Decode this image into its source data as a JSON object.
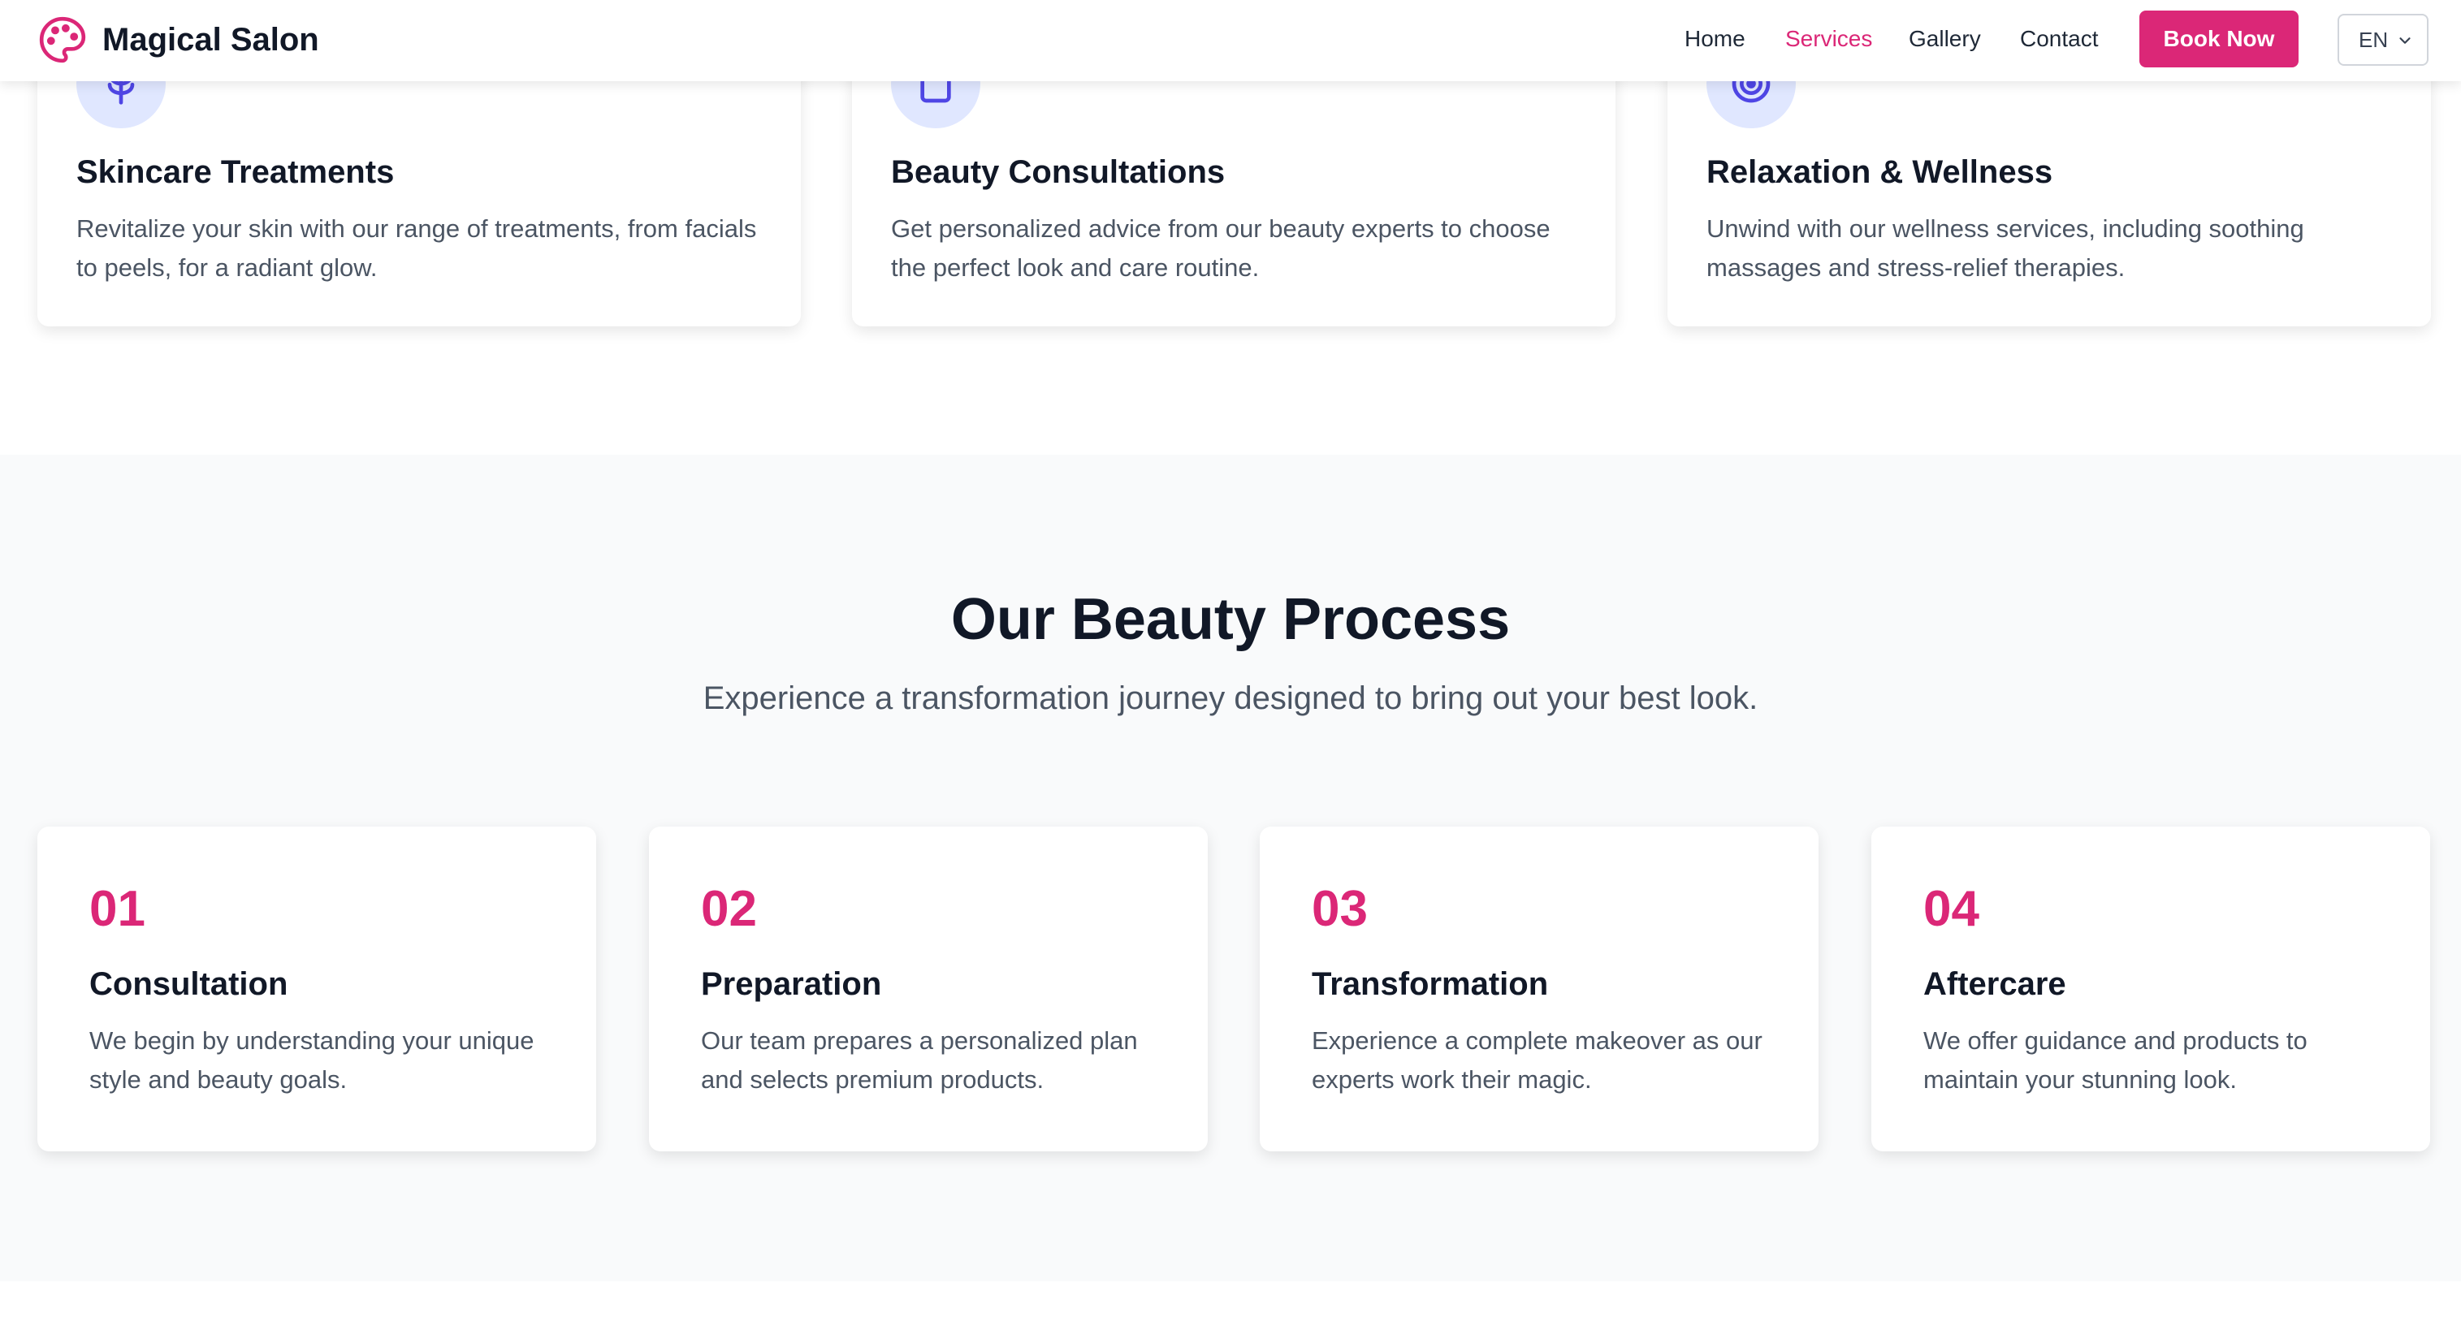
{
  "brand": {
    "name": "Magical Salon",
    "accent": "#db2777",
    "icon": "palette-icon"
  },
  "nav": {
    "items": [
      {
        "label": "Home",
        "active": false
      },
      {
        "label": "Services",
        "active": true
      },
      {
        "label": "Gallery",
        "active": false
      },
      {
        "label": "Contact",
        "active": false
      }
    ],
    "cta_label": "Book Now",
    "language": "EN"
  },
  "services": [
    {
      "icon": "leaf-icon",
      "title": "Skincare Treatments",
      "description": "Revitalize your skin with our range of treatments, from facials to peels, for a radiant glow."
    },
    {
      "icon": "clipboard-icon",
      "title": "Beauty Consultations",
      "description": "Get personalized advice from our beauty experts to choose the perfect look and care routine."
    },
    {
      "icon": "target-icon",
      "title": "Relaxation & Wellness",
      "description": "Unwind with our wellness services, including soothing massages and stress-relief therapies."
    }
  ],
  "process": {
    "title": "Our Beauty Process",
    "subtitle": "Experience a transformation journey designed to bring out your best look.",
    "steps": [
      {
        "number": "01",
        "title": "Consultation",
        "description": "We begin by understanding your unique style and beauty goals."
      },
      {
        "number": "02",
        "title": "Preparation",
        "description": "Our team prepares a personalized plan and selects premium products."
      },
      {
        "number": "03",
        "title": "Transformation",
        "description": "Experience a complete makeover as our experts work their magic."
      },
      {
        "number": "04",
        "title": "Aftercare",
        "description": "We offer guidance and products to maintain your stunning look."
      }
    ]
  }
}
